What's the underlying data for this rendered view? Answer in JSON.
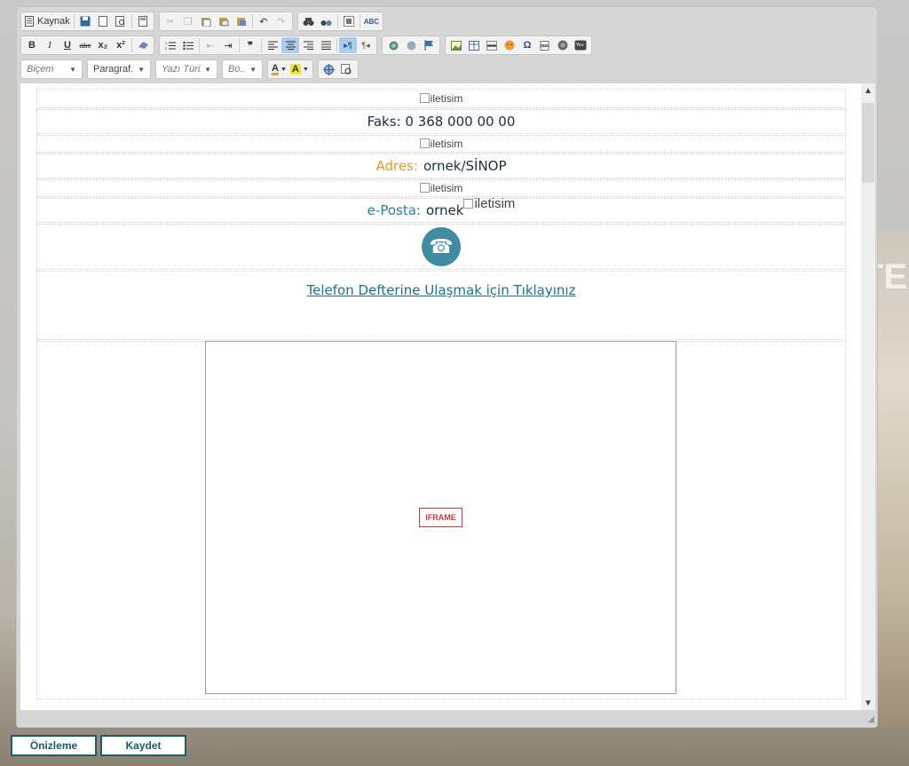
{
  "background": {
    "sign_text": "İTE"
  },
  "toolbar": {
    "row1": {
      "source_label": "Kaynak",
      "icons": [
        "source-icon",
        "save-icon",
        "new-page-icon",
        "preview-icon",
        "templates-icon",
        "cut-icon",
        "copy-icon",
        "paste-icon",
        "paste-text-icon",
        "paste-word-icon",
        "undo-icon",
        "redo-icon",
        "find-icon",
        "replace-icon",
        "select-all-icon",
        "spellcheck-icon"
      ]
    },
    "row2": {
      "bold": "B",
      "italic": "I",
      "underline": "U",
      "strike": "abc",
      "subscript": "x₂",
      "superscript": "x²",
      "blockquote": "❞",
      "spellcheck": "ABC"
    },
    "row3": {
      "style_combo": "Biçem",
      "format_combo": "Paragraf...",
      "font_combo": "Yazı Türü",
      "size_combo": "Bo...",
      "text_color": "A",
      "bg_color": "A"
    }
  },
  "content": {
    "img_alt": "iletisim",
    "fax": "Faks: 0 368 000 00 00",
    "address_label": "Adres:",
    "address_value": "ornek/SİNOP",
    "email_label": "e-Posta:",
    "email_value": "ornek",
    "phone_icon": "☎",
    "phonebook_link": "Telefon Defterine Ulaşmak için Tıklayınız",
    "iframe_label": "IFRAME"
  },
  "buttons": {
    "preview": "Önizleme",
    "save": "Kaydet"
  },
  "colors": {
    "accent": "#1e5b6b",
    "orange": "#e39a2a",
    "teal": "#2b7f95",
    "link": "#20708a"
  }
}
